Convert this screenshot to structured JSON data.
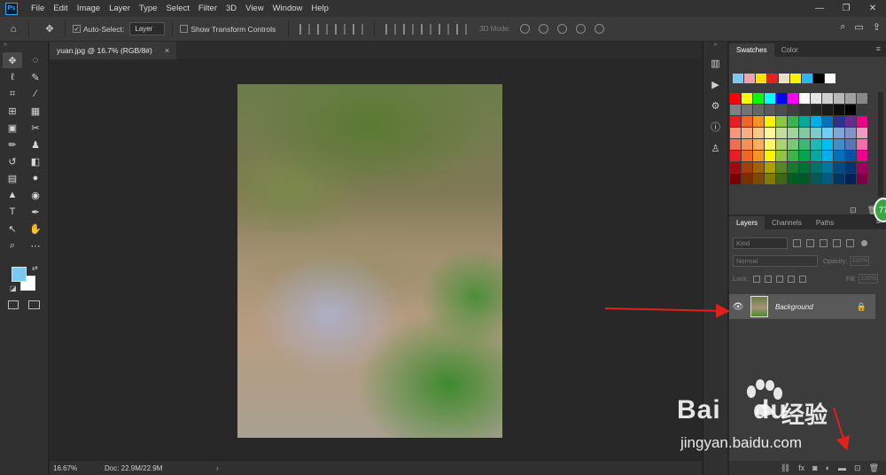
{
  "app": {
    "logo": "Ps",
    "menu": [
      "File",
      "Edit",
      "Image",
      "Layer",
      "Type",
      "Select",
      "Filter",
      "3D",
      "View",
      "Window",
      "Help"
    ],
    "window_controls": [
      "—",
      "❐",
      "✕"
    ]
  },
  "options_bar": {
    "auto_select_label": "Auto-Select:",
    "auto_select_checked": true,
    "auto_select_target": "Layer",
    "transform_controls_label": "Show Transform Controls",
    "transform_controls_checked": false,
    "mode_3d_label": "3D Mode:"
  },
  "document": {
    "tab_title": "yuan.jpg @ 16.7% (RGB/8#)",
    "close_symbol": "×",
    "zoom": "16.67%",
    "doc_info": "Doc: 22.9M/22.9M",
    "status_arrow": "›"
  },
  "tools": [
    "move-tool-icon",
    "marquee-tool-icon",
    "lasso-tool-icon",
    "quick-select-tool-icon",
    "crop-tool-icon",
    "eyedropper-tool-icon",
    "healing-brush-icon",
    "brush-tool-icon",
    "clone-stamp-icon",
    "history-brush-icon",
    "eraser-tool-icon",
    "gradient-tool-icon",
    "blur-tool-icon",
    "dodge-tool-icon",
    "pen-tool-icon",
    "type-tool-icon",
    "path-select-icon",
    "hand-tool-icon",
    "zoom-tool-icon",
    "more-tools-icon"
  ],
  "colors": {
    "foreground": "#7ec8f0",
    "background": "#ffffff",
    "arrow": "#e0201c"
  },
  "swatches_panel": {
    "tabs": [
      "Swatches",
      "Color"
    ],
    "active_tab": "Swatches",
    "recent": [
      "#7ec8f0",
      "#f4a0b0",
      "#ffe000",
      "#e82020",
      "#e8e0c8",
      "#fff200",
      "#29b6f6",
      "#000000",
      "#ffffff"
    ],
    "grid": [
      "#ff0000",
      "#ffff00",
      "#00ff00",
      "#00ffff",
      "#0000ff",
      "#ff00ff",
      "#ffffff",
      "#e6e6e6",
      "#d0d0d0",
      "#b8b8b8",
      "#a0a0a0",
      "#888888",
      "#808080",
      "#737373",
      "#666666",
      "#595959",
      "#4d4d4d",
      "#404040",
      "#333333",
      "#262626",
      "#1a1a1a",
      "#0d0d0d",
      "#000000",
      "#3a3a3a",
      "#ed1c24",
      "#f26522",
      "#f7941d",
      "#fff200",
      "#8dc63f",
      "#39b54a",
      "#00a99d",
      "#00aeef",
      "#0072bc",
      "#2e3192",
      "#662d91",
      "#ec008c",
      "#f7977a",
      "#f9ad81",
      "#fdc68a",
      "#fff79a",
      "#c4df9b",
      "#a3d39c",
      "#82ca9d",
      "#7bcdc8",
      "#6dcff6",
      "#7da7d9",
      "#8393ca",
      "#f49ac1",
      "#f26c4f",
      "#f68e55",
      "#fbaf5c",
      "#fff467",
      "#acd372",
      "#7cc576",
      "#3bb878",
      "#1abbb4",
      "#00bff3",
      "#438cca",
      "#5574b9",
      "#f06ea9",
      "#ed1c24",
      "#f26522",
      "#f7941d",
      "#fff200",
      "#8dc63f",
      "#39b54a",
      "#00a651",
      "#00a99d",
      "#00aeef",
      "#0072bc",
      "#0054a6",
      "#ec008c",
      "#9e0b0f",
      "#a0410d",
      "#a36209",
      "#aba000",
      "#598527",
      "#1a7b30",
      "#007236",
      "#00746b",
      "#0076a3",
      "#004b80",
      "#003471",
      "#9e005d",
      "#790000",
      "#7b2e00",
      "#7d4900",
      "#827b00",
      "#406618",
      "#005e20",
      "#005826",
      "#005952",
      "#005b7f",
      "#003663",
      "#002157",
      "#7b0046"
    ],
    "footer_icons": [
      "new-swatch-icon",
      "trash-icon"
    ]
  },
  "layers_panel": {
    "tabs": [
      "Layers",
      "Channels",
      "Paths"
    ],
    "active_tab": "Layers",
    "kind_placeholder": "Kind",
    "blend_mode": "Normal",
    "opacity_label": "Opacity:",
    "opacity_value": "100%",
    "lock_label": "Lock:",
    "fill_label": "Fill:",
    "fill_value": "100%",
    "layers": [
      {
        "name": "Background",
        "visible": true,
        "locked": true
      }
    ],
    "footer_icons": [
      "link-icon",
      "fx-icon",
      "mask-icon",
      "adjustment-icon",
      "group-folder-icon",
      "new-layer-icon",
      "trash-icon"
    ],
    "fx_text": "fx"
  },
  "badge": {
    "text": "77"
  },
  "watermark": {
    "brand": "Bai",
    "brand_end": "du",
    "chinese": "经验",
    "url": "jingyan.baidu.com"
  }
}
